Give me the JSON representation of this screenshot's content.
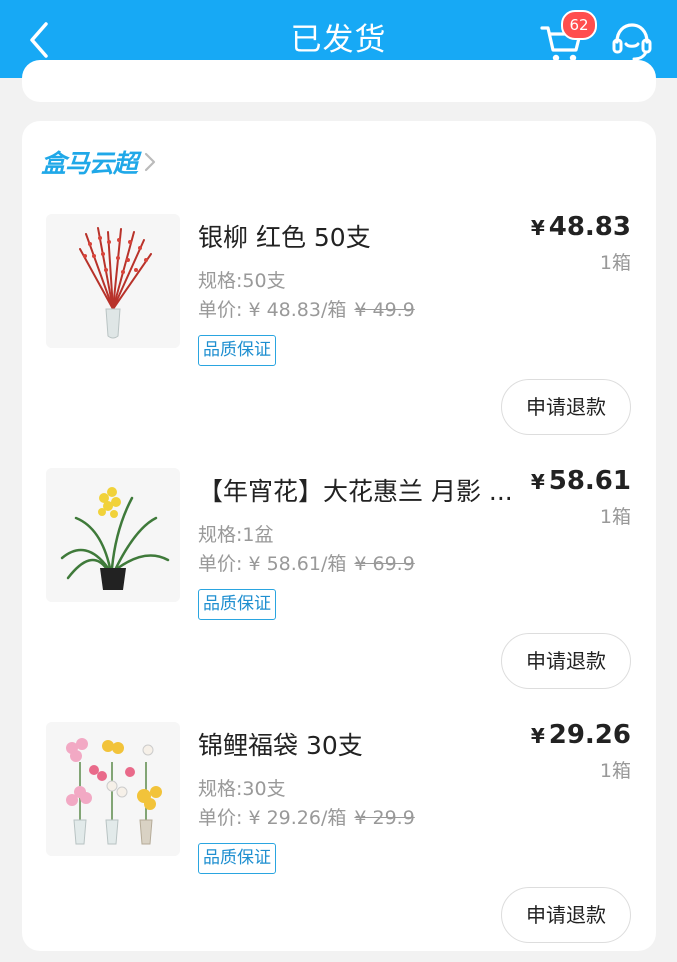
{
  "header": {
    "title": "已发货",
    "cart_count": "62"
  },
  "store": {
    "name": "盒马云超"
  },
  "items": [
    {
      "name": "银柳 红色  50支",
      "currency": "¥",
      "price": "48.83",
      "quantity": "1箱",
      "spec": "规格:50支",
      "unit_price": "单价: ¥ 48.83/箱",
      "original_price": "¥ 49.9",
      "badge": "品质保证",
      "refund_label": "申请退款",
      "image": "red-willow-branches-vase"
    },
    {
      "name": "【年宵花】大花惠兰 月影 ...",
      "currency": "¥",
      "price": "58.61",
      "quantity": "1箱",
      "spec": "规格:1盆",
      "unit_price": "单价: ¥ 58.61/箱",
      "original_price": "¥ 69.9",
      "badge": "品质保证",
      "refund_label": "申请退款",
      "image": "potted-cymbidium-orchid"
    },
    {
      "name": "锦鲤福袋  30支",
      "currency": "¥",
      "price": "29.26",
      "quantity": "1箱",
      "spec": "规格:30支",
      "unit_price": "单价: ¥ 29.26/箱",
      "original_price": "¥ 29.9",
      "badge": "品质保证",
      "refund_label": "申请退款",
      "image": "mixed-flower-bouquets"
    }
  ],
  "colors": {
    "header_bg": "#17a9f5",
    "badge_red": "#ff4e4e",
    "store_blue": "#1fa8e8"
  }
}
